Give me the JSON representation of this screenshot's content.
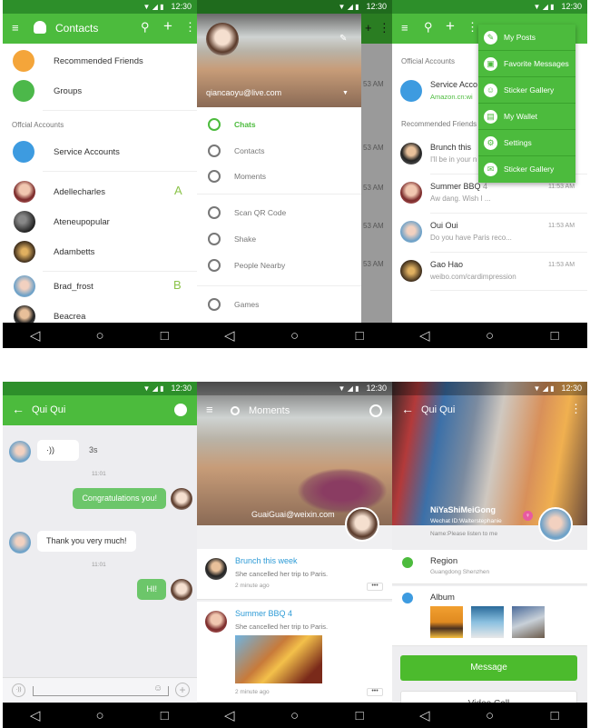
{
  "status_time": "12:30",
  "contacts": {
    "title": "Contacts",
    "recommended": "Recommended Friends",
    "groups": "Groups",
    "official_header": "Offcial Accounts",
    "service": "Service Accounts",
    "people": [
      {
        "name": "Adellecharles",
        "letter": "A"
      },
      {
        "name": "Ateneupopular",
        "letter": ""
      },
      {
        "name": "Adambetts",
        "letter": ""
      },
      {
        "name": "Brad_frost",
        "letter": "B"
      },
      {
        "name": "Beacrea",
        "letter": ""
      }
    ]
  },
  "drawer": {
    "email": "qiancaoyu@live.com",
    "items": [
      "Chats",
      "Contacts",
      "Moments",
      "Scan QR Code",
      "Shake",
      "People Nearby",
      "Games"
    ],
    "bg_times": [
      "53 AM",
      "53 AM",
      "53 AM",
      "53 AM",
      "53 AM"
    ]
  },
  "chats": {
    "official_header": "Official Accounts",
    "service_title": "Service Acco",
    "service_sub": "Amazon.cn:wi",
    "recommended_header": "Recommended Friends",
    "rows": [
      {
        "title": "Brunch this",
        "snippet": "I'll be in your n",
        "time": ""
      },
      {
        "title": "Summer BBQ",
        "count": "4",
        "snippet": "Aw dang. Wish I ...",
        "time": "11:53 AM"
      },
      {
        "title": "Oui Oui",
        "snippet": "Do you have Paris reco...",
        "time": "11:53 AM"
      },
      {
        "title": "Gao Hao",
        "snippet": "weibo.com/cardimpression",
        "time": "11:53 AM"
      }
    ],
    "menu": [
      "My Posts",
      "Favorite Messages",
      "Sticker Gallery",
      "My Wallet",
      "Settings",
      "Sticker Gallery"
    ]
  },
  "conversation": {
    "title": "Qui Qui",
    "voice_icon": "·))",
    "voice_len": "3s",
    "time1": "11:01",
    "msg1": "Congratulations you!",
    "msg2": "Thank you very much!",
    "time2": "11:01",
    "msg3": "HI!"
  },
  "moments": {
    "title": "Moments",
    "email": "GuaiGuai@weixin.com",
    "posts": [
      {
        "title": "Brunch this week",
        "text": "She cancelled her trip to Paris.",
        "time": "2 minute ago"
      },
      {
        "title": "Summer BBQ 4",
        "text": "She cancelled her trip to Paris.",
        "time": "2 minute ago"
      }
    ],
    "more": "•••"
  },
  "profile": {
    "title": "Qui Qui",
    "nickname": "NiYaShiMeiGong",
    "wechat_id": "Wechat ID:Walterstephanie",
    "name_line": "Name:Please listen to me",
    "region_label": "Region",
    "region_value": "Guangdong Shenzhen",
    "album_label": "Album",
    "message_btn": "Message",
    "video_btn": "Video Call"
  },
  "colors": {
    "primary": "#4cbb3d",
    "status": "#2d8f2a",
    "link": "#2e9bd6",
    "bubble": "#6cc66a"
  }
}
